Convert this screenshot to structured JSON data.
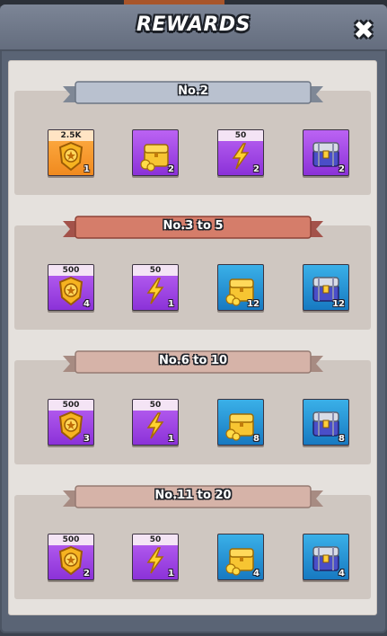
{
  "header": {
    "title": "REWARDS",
    "close_glyph": "✖"
  },
  "tiers": [
    {
      "label": "No.2",
      "ribbon_color": "#b9c1cf",
      "rewards": [
        {
          "icon": "badge-icon",
          "bg": "orange",
          "top": "2.5K",
          "count": "1"
        },
        {
          "icon": "gold-chest-icon",
          "bg": "purple",
          "top": "",
          "count": "2"
        },
        {
          "icon": "lightning-icon",
          "bg": "purple",
          "top": "50",
          "count": "2"
        },
        {
          "icon": "steel-chest-icon",
          "bg": "purple",
          "top": "",
          "count": "2"
        }
      ]
    },
    {
      "label": "No.3 to 5",
      "ribbon_color": "#d57d6a",
      "rewards": [
        {
          "icon": "badge-icon",
          "bg": "purple",
          "top": "500",
          "count": "4"
        },
        {
          "icon": "lightning-icon",
          "bg": "purple",
          "top": "50",
          "count": "1"
        },
        {
          "icon": "gold-chest-icon",
          "bg": "blue",
          "top": "",
          "count": "12"
        },
        {
          "icon": "steel-chest-icon",
          "bg": "blue",
          "top": "",
          "count": "12"
        }
      ]
    },
    {
      "label": "No.6 to 10",
      "ribbon_color": "#d6b3a8",
      "rewards": [
        {
          "icon": "badge-icon",
          "bg": "purple",
          "top": "500",
          "count": "3"
        },
        {
          "icon": "lightning-icon",
          "bg": "purple",
          "top": "50",
          "count": "1"
        },
        {
          "icon": "gold-chest-icon",
          "bg": "blue",
          "top": "",
          "count": "8"
        },
        {
          "icon": "steel-chest-icon",
          "bg": "blue",
          "top": "",
          "count": "8"
        }
      ]
    },
    {
      "label": "No.11 to 20",
      "ribbon_color": "#d6b3a8",
      "rewards": [
        {
          "icon": "badge-icon",
          "bg": "purple",
          "top": "500",
          "count": "2"
        },
        {
          "icon": "lightning-icon",
          "bg": "purple",
          "top": "50",
          "count": "1"
        },
        {
          "icon": "gold-chest-icon",
          "bg": "blue",
          "top": "",
          "count": "4"
        },
        {
          "icon": "steel-chest-icon",
          "bg": "blue",
          "top": "",
          "count": "4"
        }
      ]
    }
  ]
}
